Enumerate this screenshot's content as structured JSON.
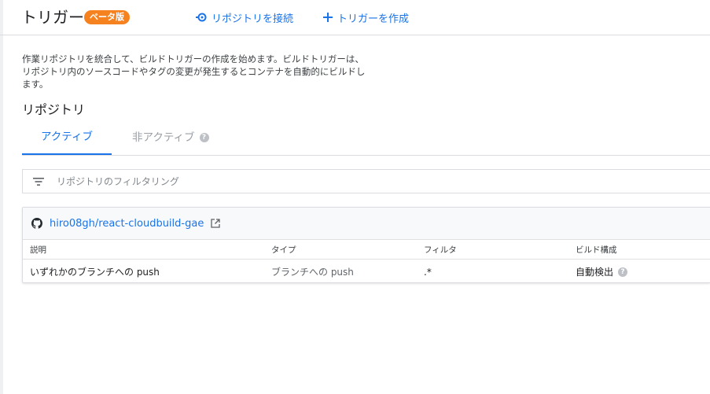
{
  "header": {
    "title": "トリガー",
    "beta_badge": "ベータ版",
    "connect_repo_label": "リポジトリを接続",
    "create_trigger_label": "トリガーを作成"
  },
  "description": "作業リポジトリを統合して、ビルドトリガーの作成を始めます。ビルドトリガーは、リポジトリ内のソースコードやタグの変更が発生するとコンテナを自動的にビルドします。",
  "section_title": "リポジトリ",
  "tabs": {
    "active_label": "アクティブ",
    "inactive_label": "非アクティブ"
  },
  "filter": {
    "placeholder": "リポジトリのフィルタリング",
    "value": ""
  },
  "repository": {
    "name": "hiro08gh/react-cloudbuild-gae",
    "columns": [
      "説明",
      "タイプ",
      "フィルタ",
      "ビルド構成"
    ],
    "rows": [
      {
        "description": "いずれかのブランチへの push",
        "type": "ブランチへの push",
        "filter": ".*",
        "build_config": "自動検出"
      }
    ]
  },
  "colors": {
    "accent": "#1a73e8",
    "beta_badge": "#f5821f",
    "divider": "#dadce0"
  },
  "icons": [
    "connect-icon",
    "plus-icon",
    "help-icon",
    "filter-icon",
    "github-icon",
    "external-link-icon"
  ]
}
